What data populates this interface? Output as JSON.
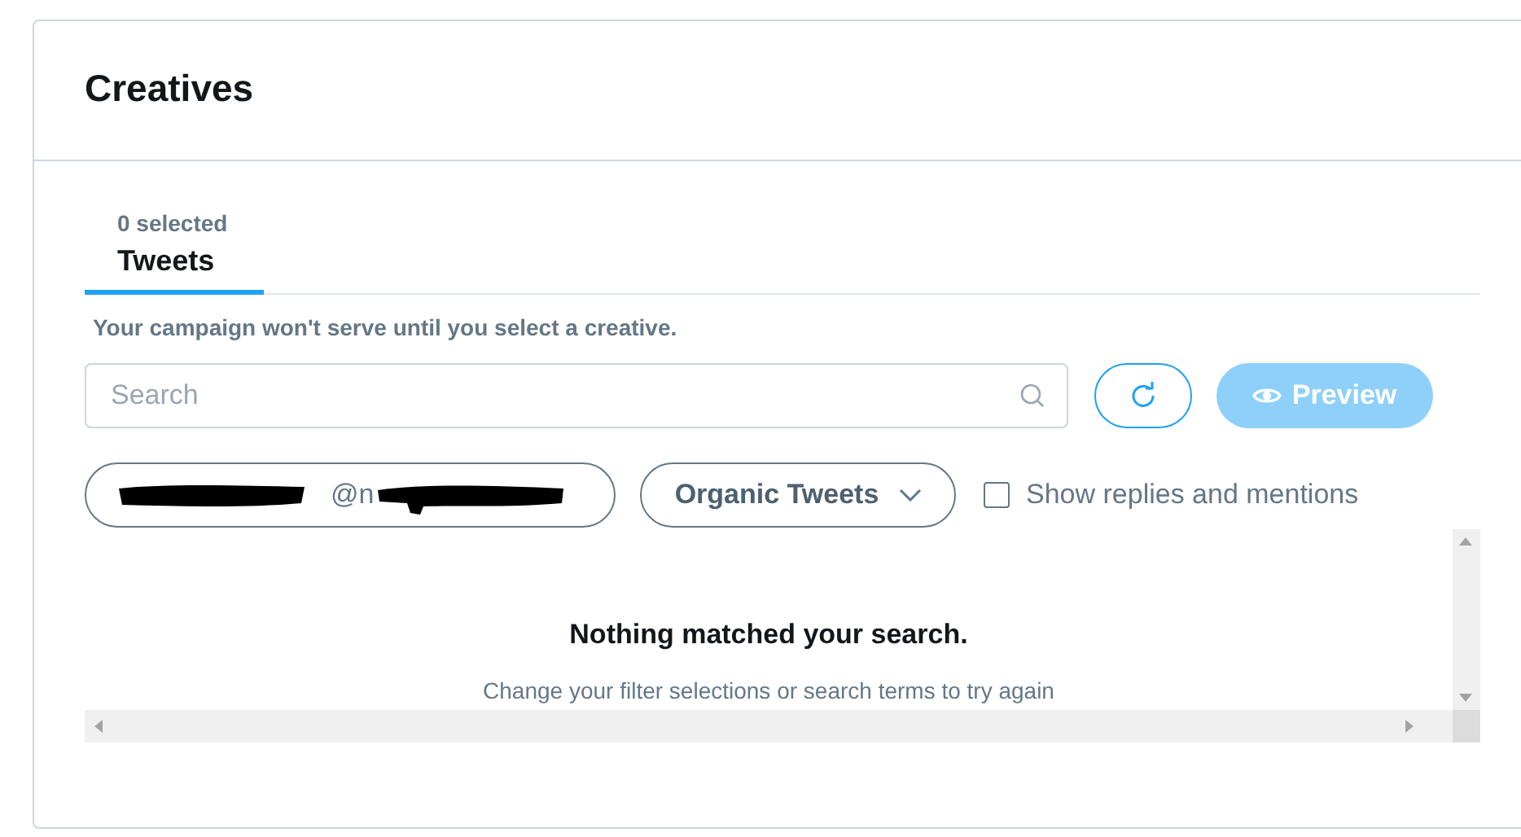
{
  "panel": {
    "title": "Creatives"
  },
  "tabs": [
    {
      "count": "0 selected",
      "label": "Tweets",
      "selected": true
    }
  ],
  "notice": "Your campaign won't serve until you select a creative.",
  "search": {
    "placeholder": "Search"
  },
  "buttons": {
    "preview": {
      "label": "Preview",
      "disabled": true
    }
  },
  "filters": {
    "account": {
      "handle": "@n",
      "redacted": true
    },
    "tweet_type": {
      "label": "Organic Tweets"
    },
    "replies": {
      "label": "Show replies and mentions",
      "checked": false
    }
  },
  "results": {
    "title": "Nothing matched your search.",
    "hint": "Change your filter selections or search terms to try again"
  }
}
